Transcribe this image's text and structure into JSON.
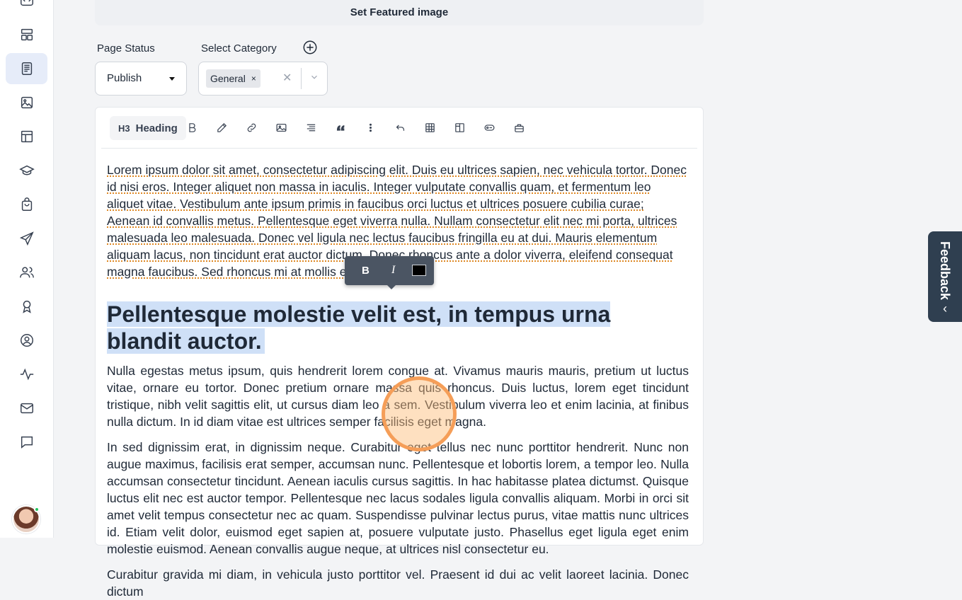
{
  "featured": {
    "label": "Set Featured image"
  },
  "status": {
    "label": "Page Status",
    "value": "Publish"
  },
  "category": {
    "label": "Select Category",
    "chip": "General",
    "chip_remove": "×",
    "clear": "✕"
  },
  "toolbar": {
    "heading_icon": "H3",
    "heading_label": "Heading"
  },
  "content": {
    "para1": "Lorem ipsum dolor sit amet, consectetur adipiscing elit. Duis eu ultrices sapien, nec vehicula tortor. Donec id nisi eros. Integer aliquet non massa in iaculis. Integer vulputate convallis quam, et fermentum leo aliquet vitae. Vestibulum ante ipsum primis in faucibus orci luctus et ultrices posuere cubilia curae; Aenean id convallis metus. Pellentesque eget viverra nulla. Nullam consectetur elit nec mi porta, ultrices malesuada leo malesuada. Donec vel ligula nec lectus faucibus fringilla eu at dui. Mauris elementum aliquam lacus, non tincidunt erat auctor dictum. Donec rhoncus ante a dolor viverra, eleifend consequat magna faucibus. Sed rhoncus mi at mollis euismod.",
    "heading": "Pellentesque molestie velit est, in tempus urna blandit auctor.",
    "para2": "Nulla egestas metus ipsum, quis hendrerit lorem congue at. Vivamus mauris mauris, pretium ut luctus vitae, ornare eu tortor. Donec pretium ornare massa quis rhoncus. Duis luctus, lorem eget tincidunt tristique, nibh velit sagittis elit, ut cursus diam leo a sem. Vestibulum viverra leo et enim lacinia, at finibus nulla dictum. In id diam vitae est ultrices semper facilisis eget magna.",
    "para3": "In sed dignissim erat, in dignissim neque. Curabitur eget tellus nec nunc porttitor hendrerit. Nunc non augue maximus, facilisis erat semper, accumsan nunc. Pellentesque et lobortis lorem, a tempor leo. Nulla accumsan consectetur tincidunt. Aenean iaculis cursus sagittis. In hac habitasse platea dictumst. Quisque luctus elit nec est auctor tempor. Pellentesque nec lacus sodales ligula convallis aliquam. Morbi in orci sit amet velit tempus consectetur nec ac quam. Suspendisse pulvinar lectus purus, vitae mattis nunc ultrices id. Etiam velit dolor, euismod eget sapien at, posuere vulputate justo. Phasellus eget ligula eget enim molestie euismod. Aenean convallis augue neque, at ultrices nisl consectetur eu.",
    "para4": "Curabitur gravida mi diam, in vehicula justo porttitor vel. Praesent id dui ac velit laoreet lacinia. Donec dictum"
  },
  "bubble": {
    "bold": "B",
    "italic": "I",
    "color": "#000000"
  },
  "feedback": {
    "label": "Feedback",
    "arrow": "‹"
  },
  "colors": {
    "accent": "#e6ecf9",
    "highlight": "#cfe0f7",
    "feedback_bg": "#2f3f50",
    "cursor": "#f59e58"
  }
}
